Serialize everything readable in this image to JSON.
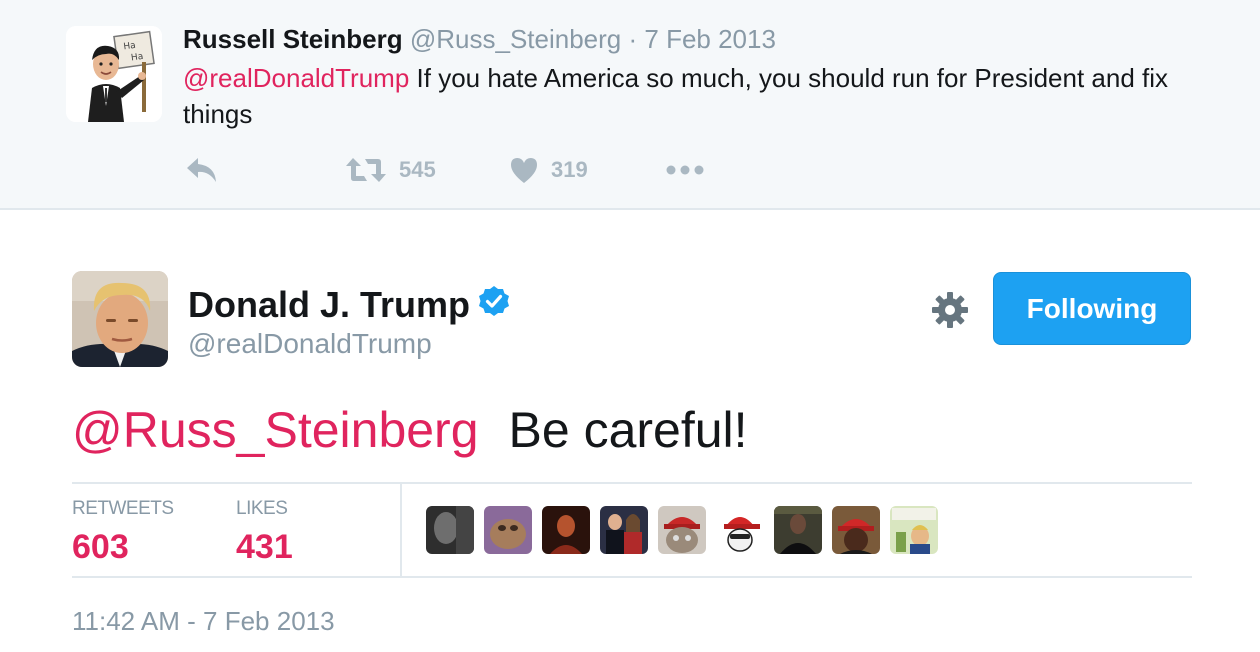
{
  "reply_tweet": {
    "author_name": "Russell Steinberg",
    "author_handle": "@Russ_Steinberg",
    "separator": "·",
    "date": "7 Feb 2013",
    "mention": "@realDonaldTrump",
    "text": " If you hate America so much, you should run for President and fix things",
    "avatar_sign_text": "Ha Ha",
    "retweet_count": "545",
    "like_count": "319"
  },
  "main_tweet": {
    "author_name": "Donald J. Trump",
    "author_handle": "@realDonaldTrump",
    "follow_button_label": "Following",
    "mention": "@Russ_Steinberg",
    "text": "Be careful!",
    "stats": {
      "retweets_label": "RETWEETS",
      "retweets_value": "603",
      "likes_label": "LIKES",
      "likes_value": "431"
    },
    "likers": [
      {
        "name": "liker-avatar-1",
        "color": "#3a3a3a"
      },
      {
        "name": "liker-avatar-2",
        "color": "#8a6a9a"
      },
      {
        "name": "liker-avatar-3",
        "color": "#4a1e14"
      },
      {
        "name": "liker-avatar-4",
        "color": "#2a2a3a"
      },
      {
        "name": "liker-avatar-5",
        "color": "#b8a898"
      },
      {
        "name": "liker-avatar-6",
        "color": "#ffffff"
      },
      {
        "name": "liker-avatar-7",
        "color": "#3a3a30"
      },
      {
        "name": "liker-avatar-8",
        "color": "#6a3a2a"
      },
      {
        "name": "liker-avatar-9",
        "color": "#c8d8a8"
      }
    ],
    "timestamp": "11:42 AM - 7 Feb 2013"
  },
  "colors": {
    "accent_blue": "#1da1f2",
    "mention_red": "#e0245e",
    "muted_gray": "#8899a6",
    "verified_blue": "#1da1f2"
  }
}
